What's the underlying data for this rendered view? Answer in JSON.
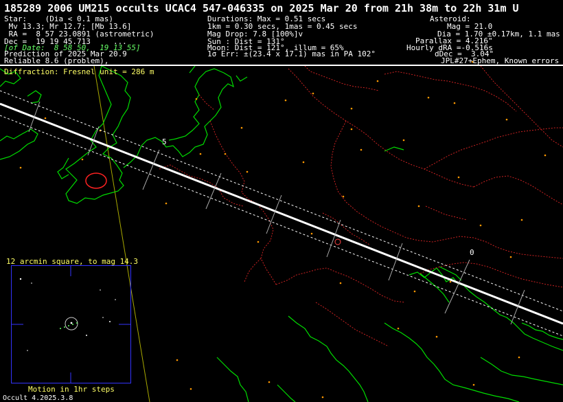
{
  "title": "185289 2006 UM215 occults UCAC4 547-046335 on 2025 Mar 20 from 21h 38m to 22h 31m U",
  "star": {
    "lines": [
      "Star:    (Dia < 0.1 mas)",
      " Mv 13.3; Mr 12.7; [Mb 13.6]",
      " RA =  8 57 23.0891 (astrometric)",
      "Dec =  19 19 45.713     ...",
      "Prediction of 2025 Mar 20.9",
      "Reliable 8.6 (problem),"
    ],
    "ofdate": "[of Date:  8 58 50,  19 13 55]"
  },
  "event": {
    "lines": [
      "Durations: Max = 0.51 secs",
      "1km = 0.30 secs, 1mas = 0.45 secs",
      "Mag Drop: 7.8 [100%]v",
      "Sun : Dist = 131°",
      "Moon: Dist = 121°, illum = 65%",
      "1σ Err: ±(23.4 x 17.1) mas in PA 102°"
    ]
  },
  "asteroid": {
    "lines": [
      "Asteroid:",
      "Mag = 21.0",
      "Dia = 1.70 ±0.17km, 1.1 mas",
      "Parallax = 4.216\"",
      "Hourly dRA =-0.516s",
      "dDec =  3.04\"",
      "JPL#27+Ephem, Known errors"
    ]
  },
  "diffraction": "Diffraction: Fresnel unit = 286 m",
  "finder_title": "12 arcmin square, to mag 14.3",
  "motion_label": "Motion in 1hr steps",
  "version": "Occult 4.2025.3.8",
  "time_labels": {
    "start": "5",
    "end": "0"
  },
  "colors": {
    "coast": "#00dd00",
    "border": "#cc2222",
    "track": "#ffffff",
    "cities": "#ff9900",
    "finder_frame": "#3333ff",
    "label_yellow": "#ffff66"
  }
}
